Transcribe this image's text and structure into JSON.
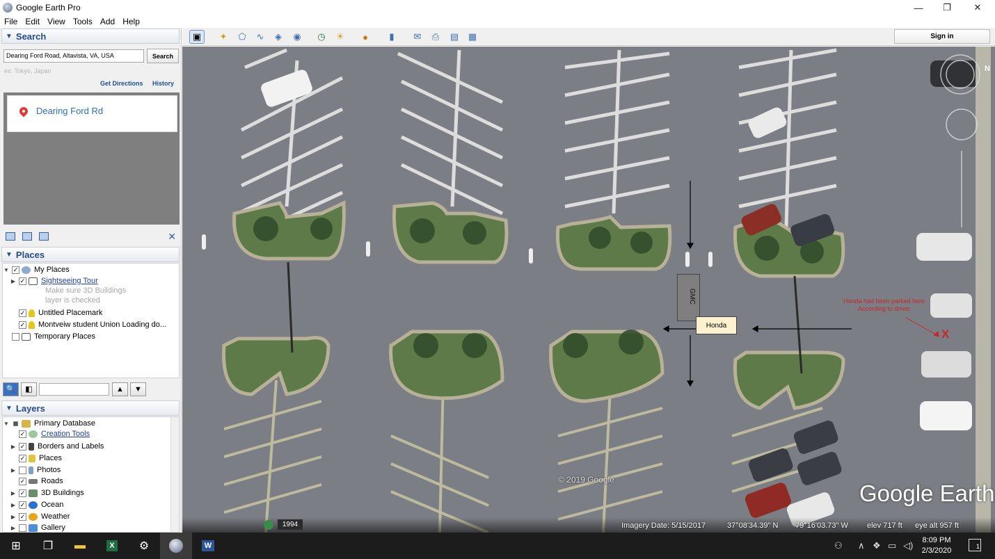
{
  "window": {
    "title": "Google Earth Pro",
    "controls": [
      "—",
      "❐",
      "✕"
    ]
  },
  "menu": [
    "File",
    "Edit",
    "View",
    "Tools",
    "Add",
    "Help"
  ],
  "search": {
    "header": "Search",
    "input_value": "Dearing Ford Road, Altavista, VA, USA",
    "button": "Search",
    "hint": "ex: Tokyo, Japan",
    "get_directions": "Get Directions",
    "history": "History",
    "result": "Dearing Ford Rd"
  },
  "places": {
    "header": "Places",
    "items": [
      {
        "label": "My Places"
      },
      {
        "label": "Sightseeing Tour"
      },
      {
        "label": "Make sure 3D Buildings"
      },
      {
        "label": "layer is checked"
      },
      {
        "label": "Untitled Placemark"
      },
      {
        "label": "Montveiw student Union Loading do..."
      },
      {
        "label": "Temporary Places"
      }
    ]
  },
  "layers": {
    "header": "Layers",
    "items": [
      {
        "label": "Primary Database"
      },
      {
        "label": "Creation Tools"
      },
      {
        "label": "Borders and Labels"
      },
      {
        "label": "Places"
      },
      {
        "label": "Photos"
      },
      {
        "label": "Roads"
      },
      {
        "label": "3D Buildings"
      },
      {
        "label": "Ocean"
      },
      {
        "label": "Weather"
      },
      {
        "label": "Gallery"
      }
    ]
  },
  "toolbar": {
    "sign_in": "Sign in",
    "icons": [
      "sidebar-toggle-icon",
      "add-placemark-icon",
      "add-polygon-icon",
      "add-path-icon",
      "add-overlay-icon",
      "record-tour-icon",
      "historical-imagery-icon",
      "sunlight-icon",
      "switch-planet-icon",
      "ruler-icon",
      "email-icon",
      "print-icon",
      "save-image-icon",
      "view-maps-icon"
    ]
  },
  "map": {
    "copyright": "© 2019 Google",
    "logo": "Google Earth",
    "imagery_date": "Imagery Date: 5/15/2017",
    "lat": "37°08'34.39\" N",
    "lon": "79°16'03.73\" W",
    "elev": "elev   717 ft",
    "eye_alt": "eye alt   957 ft",
    "history_year": "1994",
    "annotation": {
      "gmc": "GMC",
      "honda": "Honda",
      "note_line1": "Honda had been parked here",
      "note_line2": "According to driver",
      "x_mark": "X"
    },
    "compass_n": "N"
  },
  "taskbar": {
    "time": "8:09 PM",
    "date": "2/3/2020",
    "notification_count": "1"
  }
}
